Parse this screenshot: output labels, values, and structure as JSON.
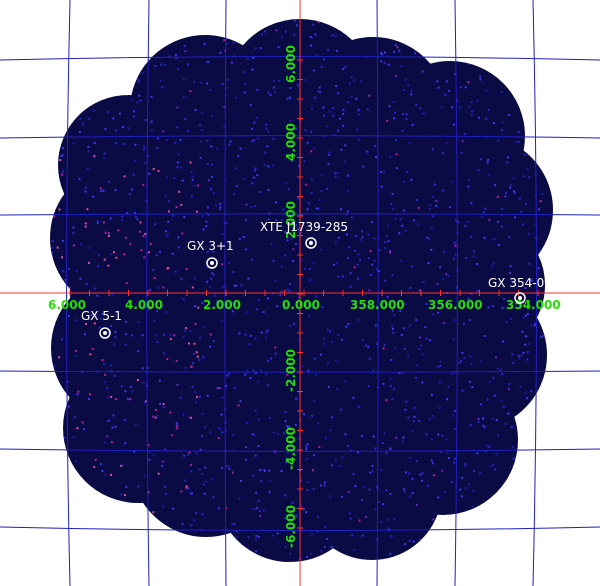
{
  "image": {
    "background_color": "#ffffff",
    "field_color": "#0a0a45",
    "grid_color": "#2020c0",
    "axis_color": "#ff3030",
    "tick_label_color": "#22e000",
    "label_color": "#ffffff"
  },
  "axes": {
    "longitude_ticks": [
      "6.000",
      "4.000",
      "2.000",
      "0.000",
      "358.000",
      "356.000",
      "354.000"
    ],
    "latitude_ticks": [
      "6.000",
      "4.000",
      "2.000",
      "-2.000",
      "-4.000",
      "-6.000"
    ]
  },
  "sources": [
    {
      "name": "GX 3+1"
    },
    {
      "name": "XTE J1739-285"
    },
    {
      "name": "GX 354-0"
    },
    {
      "name": "GX 5-1"
    }
  ]
}
